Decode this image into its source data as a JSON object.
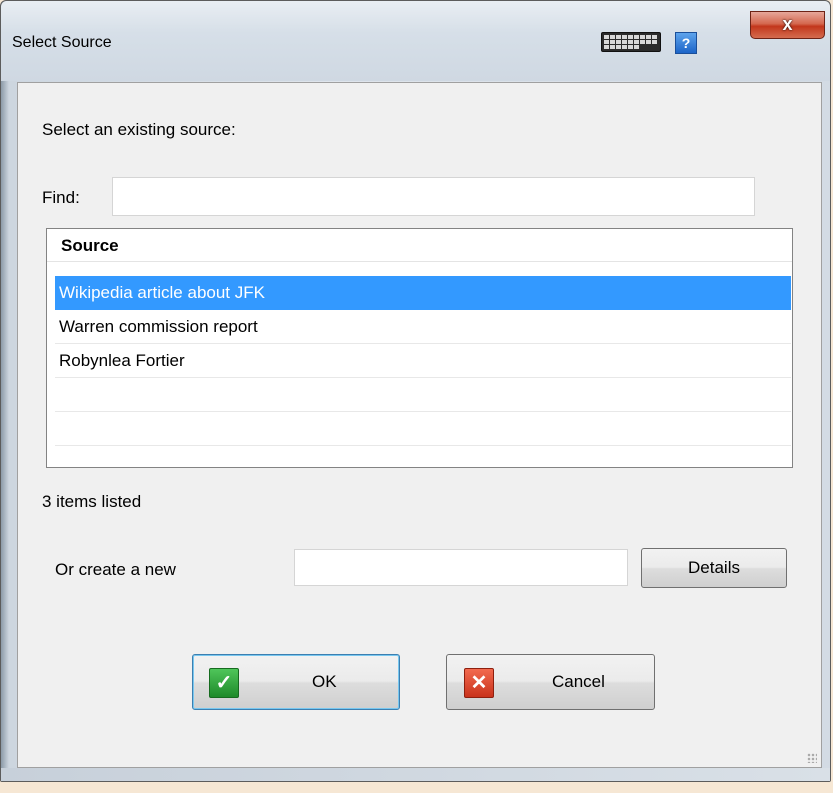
{
  "window": {
    "title": "Select Source",
    "close_label": "x",
    "help_label": "?"
  },
  "dialog": {
    "prompt": "Select an existing source:",
    "find_label": "Find:",
    "find_value": "",
    "list_header": "Source",
    "items": [
      {
        "label": "Wikipedia article about JFK",
        "selected": true
      },
      {
        "label": "Warren commission report",
        "selected": false
      },
      {
        "label": "Robynlea Fortier",
        "selected": false
      }
    ],
    "count_text": "3 items listed",
    "create_label": "Or create a new",
    "create_value": "",
    "details_label": "Details",
    "ok_label": "OK",
    "cancel_label": "Cancel"
  },
  "icons": {
    "ok": "checkmark-icon",
    "cancel": "x-icon",
    "keyboard": "keyboard-icon",
    "help": "help-icon"
  },
  "colors": {
    "selection": "#3399ff",
    "ok_icon": "#2a9a35",
    "cancel_icon": "#d9391f",
    "close_button": "#c2371c"
  }
}
